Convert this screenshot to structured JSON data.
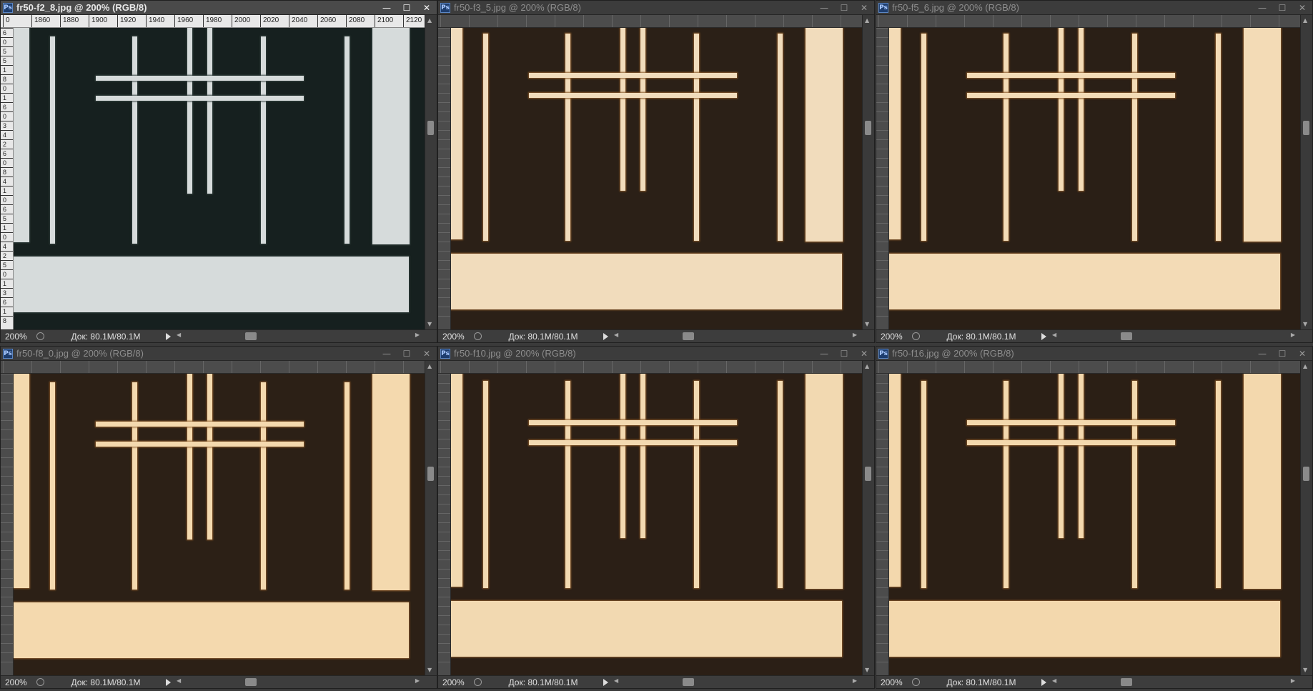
{
  "app_icon": "Ps",
  "window_controls": {
    "minimize": "—",
    "maximize": "☐",
    "close": "✕"
  },
  "ruler": {
    "top": [
      "0",
      "1860",
      "1880",
      "1900",
      "1920",
      "1940",
      "1960",
      "1980",
      "2000",
      "2020",
      "2040",
      "2060",
      "2080",
      "2100",
      "2120"
    ],
    "left": [
      "6",
      "0",
      "5",
      "5",
      "1",
      "8",
      "0",
      "1",
      "6",
      "0",
      "3",
      "4",
      "2",
      "6",
      "0",
      "8",
      "4",
      "1",
      "0",
      "6",
      "5",
      "1",
      "0",
      "4",
      "2",
      "5",
      "0",
      "1",
      "3",
      "6",
      "1",
      "8"
    ]
  },
  "windows": [
    {
      "title": "fr50-f2_8.jpg @ 200% (RGB/8)",
      "active": true,
      "zoom": "200%",
      "doc": "Док: 80.1M/80.1M",
      "colors": {
        "bg": "#16201f",
        "fg": "#d6dbdb",
        "rim": "#33403e"
      }
    },
    {
      "title": "fr50-f3_5.jpg @ 200% (RGB/8)",
      "active": false,
      "zoom": "200%",
      "doc": "Док: 80.1M/80.1M",
      "colors": {
        "bg": "#2b2017",
        "fg": "#f1dcbc",
        "rim": "#8a5a2a"
      }
    },
    {
      "title": "fr50-f5_6.jpg @ 200% (RGB/8)",
      "active": false,
      "zoom": "200%",
      "doc": "Док: 80.1M/80.1M",
      "colors": {
        "bg": "#2a1f16",
        "fg": "#f3dbb6",
        "rim": "#8a5a2a"
      }
    },
    {
      "title": "fr50-f8_0.jpg @ 200% (RGB/8)",
      "active": false,
      "zoom": "200%",
      "doc": "Док: 80.1M/80.1M",
      "colors": {
        "bg": "#2c2016",
        "fg": "#f4d9ae",
        "rim": "#8a5a2a"
      }
    },
    {
      "title": "fr50-f10.jpg @ 200% (RGB/8)",
      "active": false,
      "zoom": "200%",
      "doc": "Док: 80.1M/80.1M",
      "colors": {
        "bg": "#2b1f16",
        "fg": "#f2d9b1",
        "rim": "#8a5a2a"
      }
    },
    {
      "title": "fr50-f16.jpg @ 200% (RGB/8)",
      "active": false,
      "zoom": "200%",
      "doc": "Док: 80.1M/80.1M",
      "colors": {
        "bg": "#2b1f15",
        "fg": "#f3d8ad",
        "rim": "#8a5a2a"
      }
    }
  ]
}
